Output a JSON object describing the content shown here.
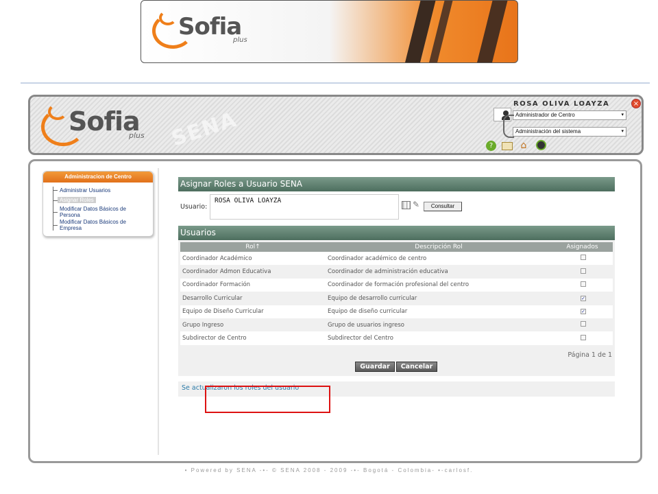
{
  "colors": {
    "accent": "#ef7f1a",
    "bar": "#5d7d6d",
    "link": "#2a7aa8",
    "highlight": "#dd1111"
  },
  "branding": {
    "banner_logo_word": "Sofia",
    "banner_logo_sub": "plus",
    "header_logo_word": "Sofia",
    "header_logo_sub": "plus",
    "watermark": "SENA"
  },
  "header": {
    "user_name": "ROSA OLIVA LOAYZA",
    "role_select": {
      "value": "Administrador de Centro"
    },
    "module_select": {
      "value": "Administración del sistema"
    },
    "icons": [
      "help-icon",
      "mail-icon",
      "home-icon",
      "power-icon"
    ]
  },
  "sidebar": {
    "title": "Administracion de Centro",
    "items": [
      {
        "label": "Administrar Usuarios",
        "active": false
      },
      {
        "label": "Asignar Roles",
        "active": true
      },
      {
        "label": "Modificar Datos Básicos de",
        "label2": "Persona",
        "active": false
      },
      {
        "label": "Modificar Datos Básicos de",
        "label2": "Empresa",
        "active": false
      }
    ]
  },
  "main": {
    "title": "Asignar Roles a Usuario SENA",
    "usuario_label": "Usuario:",
    "usuario_value": "ROSA OLIVA LOAYZA",
    "consultar_label": "Consultar",
    "section_title": "Usuarios",
    "columns": [
      "Rol↑",
      "Descripción Rol",
      "Asignados"
    ],
    "rows": [
      {
        "rol": "Coordinador Académico",
        "desc": "Coordinador académico de centro",
        "checked": false
      },
      {
        "rol": "Coordinador Admon Educativa",
        "desc": "Coordinador de administración educativa",
        "checked": false
      },
      {
        "rol": "Coordinador Formación",
        "desc": "Coordinador de formación profesional del centro",
        "checked": false
      },
      {
        "rol": "Desarrollo Curricular",
        "desc": "Equipo de desarrollo curricular",
        "checked": true
      },
      {
        "rol": "Equipo de Diseño Curricular",
        "desc": "Equipo de diseño curricular",
        "checked": true
      },
      {
        "rol": "Grupo Ingreso",
        "desc": "Grupo de usuarios ingreso",
        "checked": false
      },
      {
        "rol": "Subdirector de Centro",
        "desc": "Subdirector del Centro",
        "checked": false
      }
    ],
    "pager": "Página 1 de 1",
    "guardar_label": "Guardar",
    "cancelar_label": "Cancelar",
    "status_message": "Se actualizaron los roles del usuario"
  },
  "footer": "• Powered by SENA -•- © SENA 2008 - 2009 -•- Bogotá - Colombia- •-carlosf."
}
